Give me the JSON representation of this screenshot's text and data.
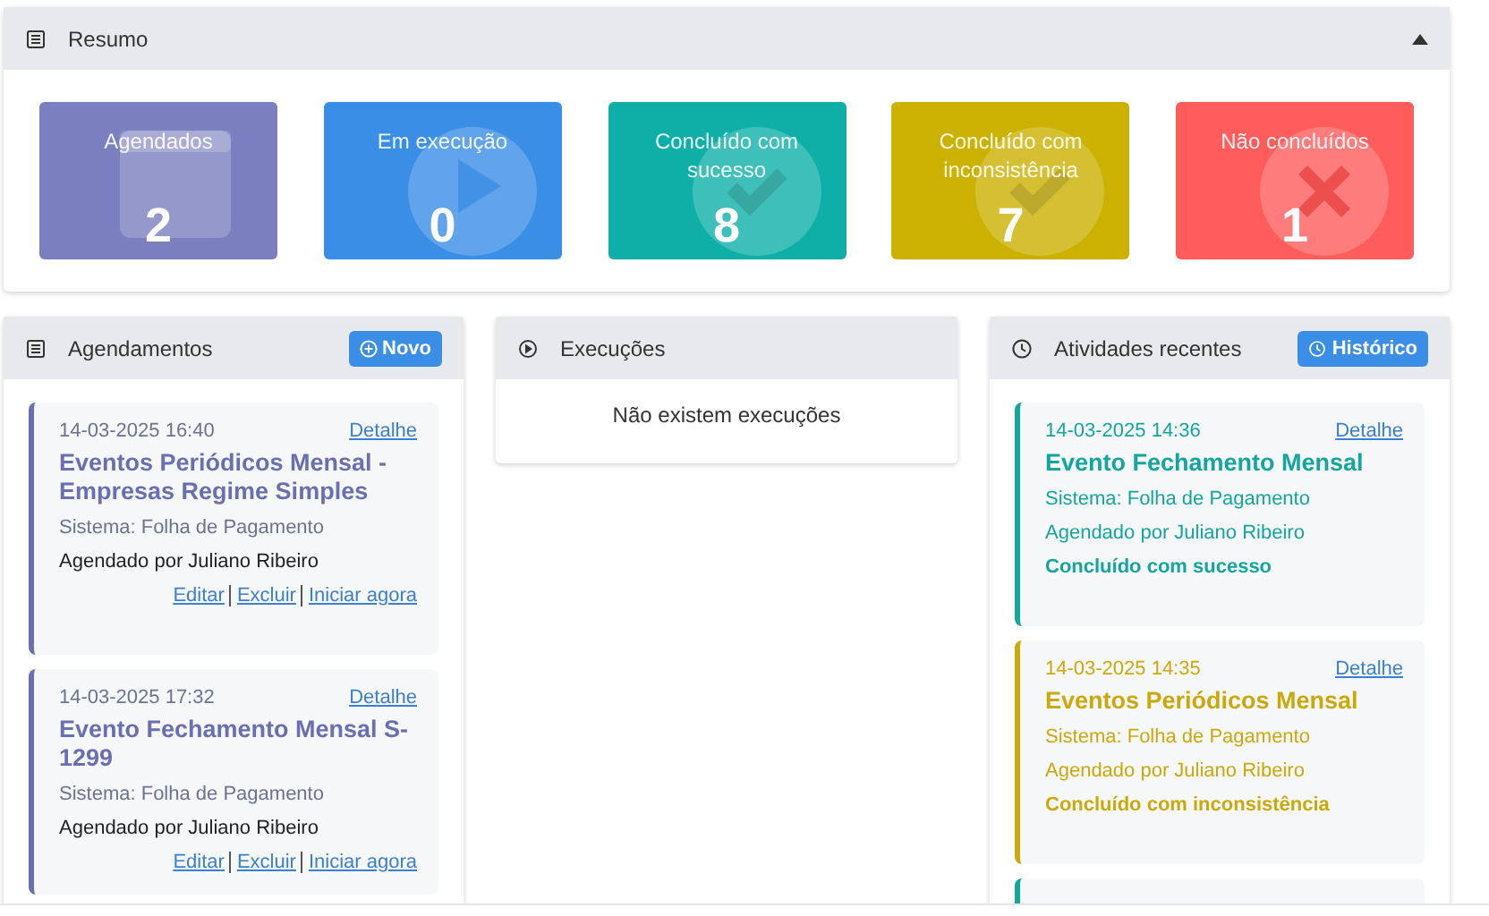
{
  "summary": {
    "title": "Resumo",
    "expanded": true,
    "cards": [
      {
        "kind": "calendar",
        "label": "Agendados",
        "count": "2",
        "color": "#7a7fbf"
      },
      {
        "kind": "play",
        "label": "Em execução",
        "count": "0",
        "color": "#3a8ee6"
      },
      {
        "kind": "check",
        "label": "Concluído com sucesso",
        "count": "8",
        "color": "#0fafa8"
      },
      {
        "kind": "check",
        "label": "Concluído com inconsistência",
        "count": "7",
        "color": "#cbb100"
      },
      {
        "kind": "cross",
        "label": "Não concluídos",
        "count": "1",
        "color": "#ff5c5c"
      }
    ]
  },
  "schedules": {
    "title": "Agendamentos",
    "button": "Novo",
    "items": [
      {
        "datetime": "14-03-2025 16:40",
        "detail": "Detalhe",
        "name": "Eventos Periódicos Mensal - Empresas Regime Simples",
        "system": "Sistema: Folha de Pagamento",
        "by": "Agendado por Juliano Ribeiro",
        "actions": [
          "Editar",
          "Excluir",
          "Iniciar agora"
        ]
      },
      {
        "datetime": "14-03-2025 17:32",
        "detail": "Detalhe",
        "name": "Evento Fechamento Mensal S-1299",
        "system": "Sistema: Folha de Pagamento",
        "by": "Agendado por Juliano Ribeiro",
        "actions": [
          "Editar",
          "Excluir",
          "Iniciar agora"
        ]
      }
    ]
  },
  "executions": {
    "title": "Execuções",
    "empty": "Não existem execuções"
  },
  "activities": {
    "title": "Atividades recentes",
    "button": "Histórico",
    "items": [
      {
        "color": "#14a59d",
        "datetime": "14-03-2025 14:36",
        "detail": "Detalhe",
        "name": "Evento Fechamento Mensal",
        "system": "Sistema: Folha de Pagamento",
        "by": "Agendado por Juliano Ribeiro",
        "status": "Concluído com sucesso"
      },
      {
        "color": "#c9a90c",
        "datetime": "14-03-2025 14:35",
        "detail": "Detalhe",
        "name": "Eventos Periódicos Mensal",
        "system": "Sistema: Folha de Pagamento",
        "by": "Agendado por Juliano Ribeiro",
        "status": "Concluído com inconsistência"
      },
      {
        "color": "#14a59d"
      }
    ]
  }
}
